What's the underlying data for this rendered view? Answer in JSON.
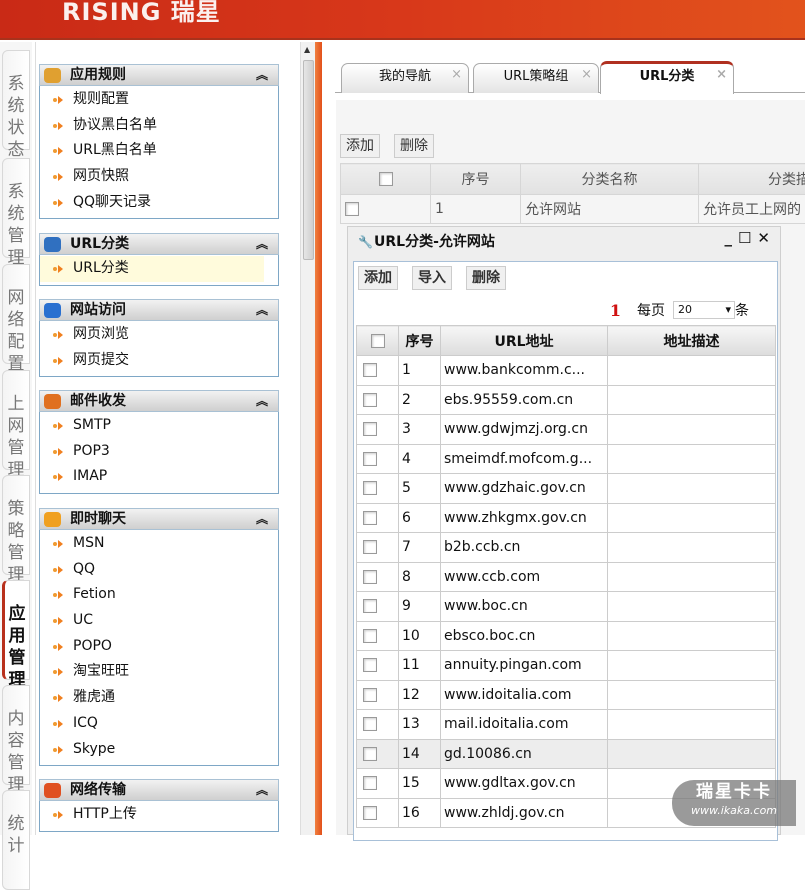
{
  "header": {
    "logo": "RISING 瑞星"
  },
  "vtabs": [
    {
      "label": "系统状态"
    },
    {
      "label": "系统管理"
    },
    {
      "label": "网络配置"
    },
    {
      "label": "上网管理"
    },
    {
      "label": "策略管理"
    },
    {
      "label": "应用管理",
      "active": true
    },
    {
      "label": "内容管理"
    },
    {
      "label": "统计"
    }
  ],
  "sidebar": {
    "groups": [
      {
        "title": "应用规则",
        "icon": "rules-icon",
        "items": [
          "规则配置",
          "协议黑白名单",
          "URL黑白名单",
          "网页快照",
          "QQ聊天记录"
        ]
      },
      {
        "title": "URL分类",
        "icon": "url-category-icon",
        "items": [
          "URL分类"
        ]
      },
      {
        "title": "网站访问",
        "icon": "ie-globe-icon",
        "items": [
          "网页浏览",
          "网页提交"
        ]
      },
      {
        "title": "邮件收发",
        "icon": "mailbox-icon",
        "items": [
          "SMTP",
          "POP3",
          "IMAP"
        ]
      },
      {
        "title": "即时聊天",
        "icon": "chat-users-icon",
        "items": [
          "MSN",
          "QQ",
          "Fetion",
          "UC",
          "POPO",
          "淘宝旺旺",
          "雅虎通",
          "ICQ",
          "Skype"
        ]
      },
      {
        "title": "网络传输",
        "icon": "transfer-icon",
        "items": [
          "HTTP上传"
        ]
      }
    ]
  },
  "tabs": [
    {
      "label": "我的导航"
    },
    {
      "label": "URL策略组"
    },
    {
      "label": "URL分类",
      "active": true
    }
  ],
  "toolbar": {
    "add": "添加",
    "delete": "删除"
  },
  "maintable": {
    "headers": [
      "序号",
      "分类名称",
      "分类描"
    ],
    "rows": [
      {
        "no": "1",
        "name": "允许网站",
        "desc": "允许员工上网的"
      }
    ]
  },
  "dialog": {
    "title": "URL分类-允许网站",
    "add": "添加",
    "import": "导入",
    "delete": "删除",
    "pager": {
      "page": "1",
      "per_page_label": "每页",
      "per_page": "20",
      "unit": "条"
    },
    "headers": [
      "序号",
      "URL地址",
      "地址描述"
    ],
    "rows": [
      {
        "no": "1",
        "url": "www.bankcomm.c..."
      },
      {
        "no": "2",
        "url": "ebs.95559.com.cn"
      },
      {
        "no": "3",
        "url": "www.gdwjmzj.org.cn"
      },
      {
        "no": "4",
        "url": "smeimdf.mofcom.g..."
      },
      {
        "no": "5",
        "url": "www.gdzhaic.gov.cn"
      },
      {
        "no": "6",
        "url": "www.zhkgmx.gov.cn"
      },
      {
        "no": "7",
        "url": "b2b.ccb.cn"
      },
      {
        "no": "8",
        "url": "www.ccb.com"
      },
      {
        "no": "9",
        "url": "www.boc.cn"
      },
      {
        "no": "10",
        "url": "ebsco.boc.cn"
      },
      {
        "no": "11",
        "url": "annuity.pingan.com"
      },
      {
        "no": "12",
        "url": "www.idoitalia.com"
      },
      {
        "no": "13",
        "url": "mail.idoitalia.com"
      },
      {
        "no": "14",
        "url": "gd.10086.cn"
      },
      {
        "no": "15",
        "url": "www.gdltax.gov.cn"
      },
      {
        "no": "16",
        "url": "www.zhldj.gov.cn"
      }
    ]
  },
  "watermark": {
    "line1": "瑞星卡卡",
    "line2": "www.ikaka.com"
  }
}
